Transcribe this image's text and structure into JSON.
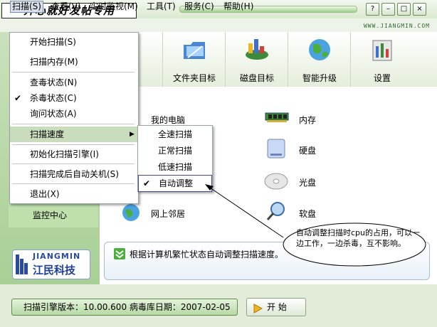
{
  "title_tag": "开心就好发帖专用",
  "window_buttons": {
    "help": "?",
    "minimize": "–",
    "maximize": "□",
    "close": "×"
  },
  "menubar": [
    "扫描(S)",
    "查看(V)",
    "实时监视(M)",
    "工具(T)",
    "服务(C)",
    "帮助(H)"
  ],
  "brand_url": "WWW.JIANGMIN.COM",
  "toolbar": [
    {
      "label": "标",
      "icon": "monitor-icon"
    },
    {
      "label": "文件夹目标",
      "icon": "folder-icon"
    },
    {
      "label": "磁盘目标",
      "icon": "disk-chart-icon"
    },
    {
      "label": "智能升级",
      "icon": "globe-icon"
    },
    {
      "label": "设置",
      "icon": "settings-icon"
    }
  ],
  "targets": {
    "my_computer": "我的电脑",
    "memory": "内存",
    "hard_disk": "硬盘",
    "optical": "光盘",
    "network": "网上邻居",
    "floppy": "软盘"
  },
  "left_panel": {
    "monitor_center": "监控中心"
  },
  "logo": {
    "en": "JIANGMIN",
    "cn": "江民科技"
  },
  "scan_menu": [
    {
      "label": "开始扫描(S)",
      "checked": false
    },
    {
      "label": "扫描内存(M)",
      "checked": false
    },
    {
      "label": "查毒状态(N)",
      "checked": false
    },
    {
      "label": "杀毒状态(C)",
      "checked": true
    },
    {
      "label": "询问状态(A)",
      "checked": false
    },
    {
      "label": "扫描速度",
      "checked": false
    },
    {
      "label": "初始化扫描引擎(I)",
      "checked": false
    },
    {
      "label": "扫描完成后自动关机(S)",
      "checked": false
    },
    {
      "label": "退出(X)",
      "checked": false
    }
  ],
  "speed_menu": [
    {
      "label": "全速扫描",
      "checked": false
    },
    {
      "label": "正常扫描",
      "checked": false
    },
    {
      "label": "低速扫描",
      "checked": false
    },
    {
      "label": "自动调整",
      "checked": true
    }
  ],
  "info_text": "根据计算机繁忙状态自动调整扫描速度。",
  "annotation": "自动调整扫描时cpu的占用，可以一边工作，一边杀毒，互不影响。",
  "status": {
    "version": "扫描引擎版本：10.00.600    病毒库日期：2007-02-05",
    "start": "开 始"
  },
  "colors": {
    "accent_green": "#a9cf96",
    "menu_highlight": "#c9ddbc"
  }
}
